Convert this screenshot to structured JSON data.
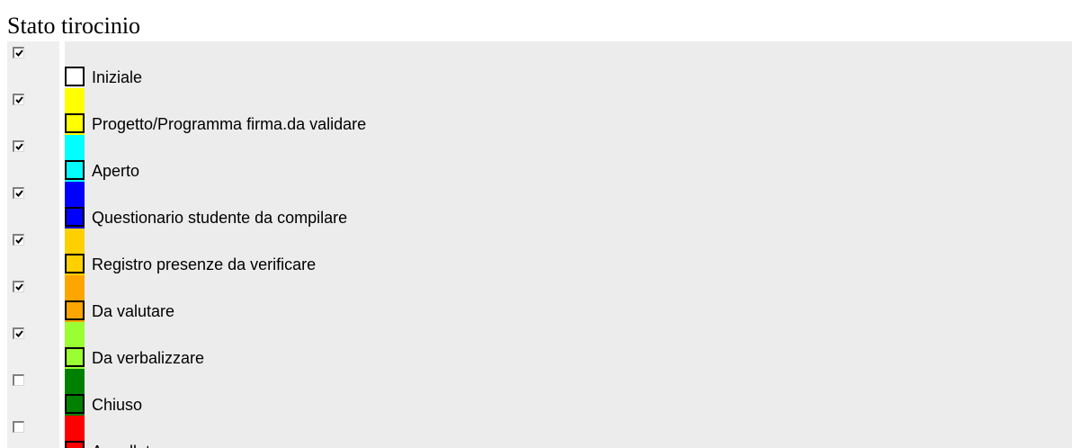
{
  "title": "Stato tirocinio",
  "states": [
    {
      "label": "Iniziale",
      "checked": true,
      "color": "#ffffff"
    },
    {
      "label": "Progetto/Programma firma.da validare",
      "checked": true,
      "color": "#ffff00"
    },
    {
      "label": "Aperto",
      "checked": true,
      "color": "#00ffff"
    },
    {
      "label": "Questionario studente da compilare",
      "checked": true,
      "color": "#0000ff"
    },
    {
      "label": "Registro presenze da verificare",
      "checked": true,
      "color": "#ffd000"
    },
    {
      "label": "Da valutare",
      "checked": true,
      "color": "#ffa500"
    },
    {
      "label": "Da verbalizzare",
      "checked": true,
      "color": "#99ff33"
    },
    {
      "label": "Chiuso",
      "checked": false,
      "color": "#008000"
    },
    {
      "label": "Annullato",
      "checked": false,
      "color": "#ff0000"
    }
  ]
}
